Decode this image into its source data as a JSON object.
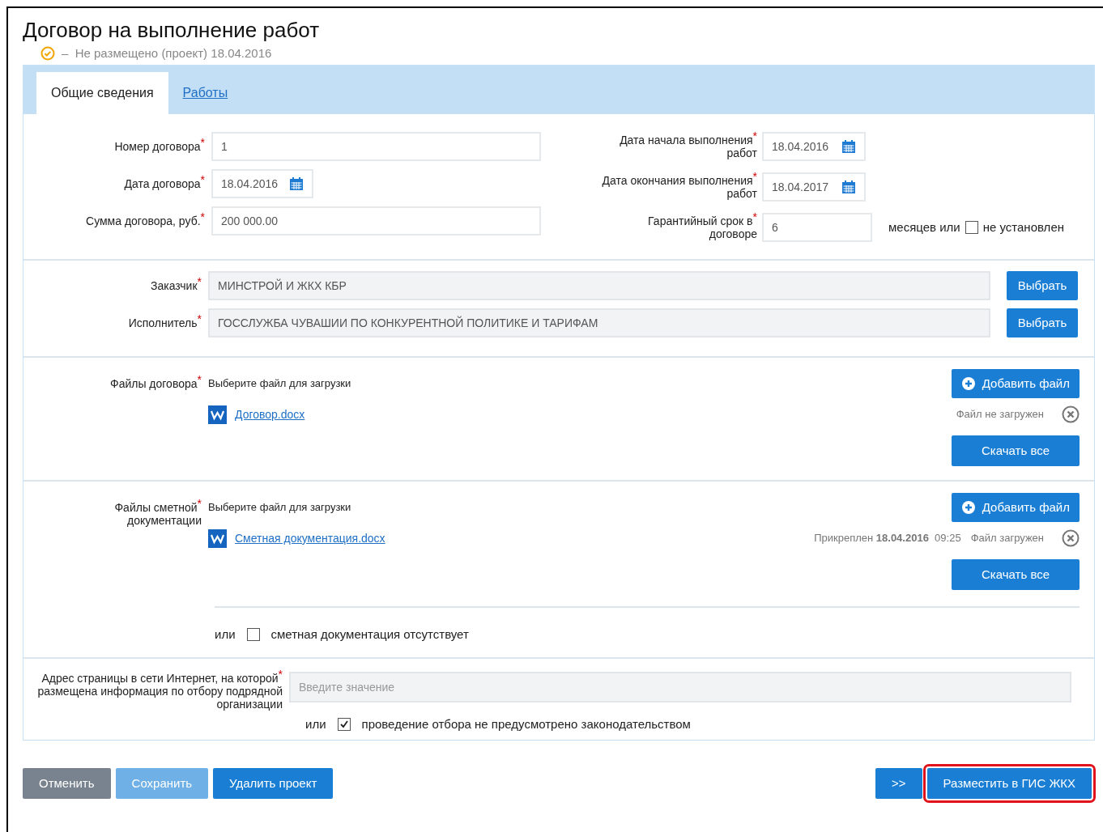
{
  "title": "Договор на выполнение работ",
  "status": {
    "text": "–  Не размещено (проект) 18.04.2016"
  },
  "tabs": [
    {
      "label": "Общие сведения",
      "selected": true
    },
    {
      "label": "Работы",
      "selected": false
    }
  ],
  "fields_left": [
    {
      "label": "Номер договора$^{*}$",
      "value": "1",
      "kind": "text"
    },
    {
      "label": "Дата договора$^{*}$",
      "value": "18.04.2016",
      "kind": "date"
    },
    {
      "label": "Сумма договора, руб.$^{*}$",
      "value": "200 000.00",
      "kind": "text"
    }
  ],
  "fields_right": [
    {
      "label": "Дата начала выполнения$^{*}$ работ",
      "value": "18.04.2016",
      "kind": "date"
    },
    {
      "label": "Дата окончания выполнения$^{*}$ работ",
      "value": "18.04.2017",
      "kind": "date"
    },
    {
      "label": "Гарантийный срок в$^{*}$ договоре",
      "value": "6",
      "kind": "term",
      "suffix": "месяцев или",
      "option": {
        "label": "не установлен",
        "checked": false
      }
    }
  ],
  "parties": [
    {
      "label": "Заказчик$^{*}$",
      "value": "МИНСТРОЙ И ЖКХ КБР",
      "button": "Выбрать"
    },
    {
      "label": "Исполнитель$^{*}$",
      "value": "ГОССЛУЖБА ЧУВАШИИ ПО КОНКУРЕНТНОЙ ПОЛИТИКЕ И ТАРИФАМ",
      "button": "Выбрать"
    }
  ],
  "file_sections": [
    {
      "label": "Файлы договора$^{*}$",
      "hint": "Выберите файл для загрузки",
      "add_button": "Добавить файл",
      "file": "Договор.docx",
      "file_status": "Файл не загружен",
      "download_button": "Скачать все"
    },
    {
      "label": "Файлы сметной$^{*}$ документации",
      "hint": "Выберите файл для загрузки",
      "add_button": "Добавить файл",
      "file": "Сметная документация.docx",
      "attached": "Прикреплен **18.04.2016**  09:25",
      "file_status": "Файл загружен",
      "download_button": "Скачать все",
      "option": {
        "prefix": "или",
        "label": "сметная документация отсутствует",
        "checked": false
      }
    }
  ],
  "address": {
    "label": "Адрес страницы в сети Интернет, на которой$^{*}$ размещена информация по отбору подрядной организации",
    "placeholder": "Введите значение",
    "option": {
      "prefix": "или",
      "label": "проведение отбора не предусмотрено законодательством",
      "checked": true
    }
  },
  "buttons_left": [
    {
      "label": "Отменить",
      "kind": "secondary"
    },
    {
      "label": "Сохранить",
      "kind": "disabled"
    },
    {
      "label": "Удалить проект",
      "kind": "primary"
    }
  ],
  "buttons_right": [
    {
      "label": ">>",
      "kind": "primary",
      "highlighted": false
    },
    {
      "label": "Разместить в ГИС ЖКХ",
      "kind": "primary",
      "highlighted": true
    }
  ]
}
